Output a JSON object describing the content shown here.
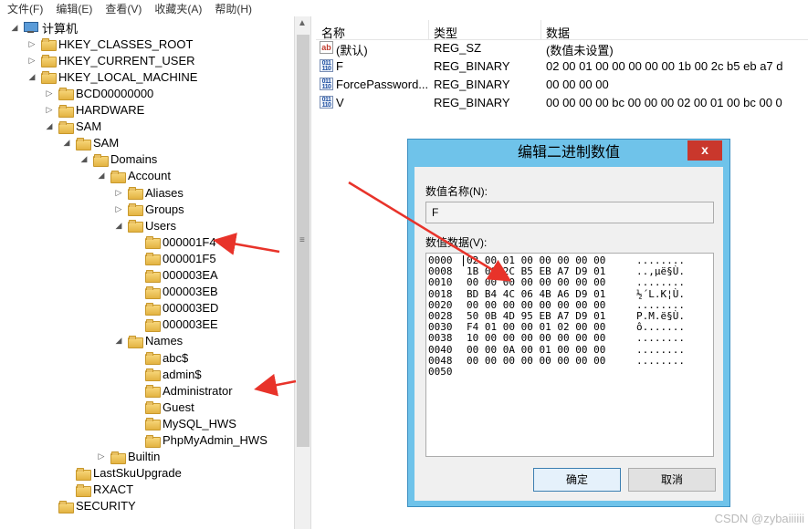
{
  "menubar": [
    "文件(F)",
    "编辑(E)",
    "查看(V)",
    "收藏夹(A)",
    "帮助(H)"
  ],
  "tree": [
    {
      "label": "计算机",
      "exp": "◢",
      "icon": "computer"
    },
    {
      "label": "HKEY_CLASSES_ROOT",
      "exp": "▷"
    },
    {
      "label": "HKEY_CURRENT_USER",
      "exp": "▷"
    },
    {
      "label": "HKEY_LOCAL_MACHINE",
      "exp": "◢"
    },
    {
      "label": "BCD00000000",
      "exp": "▷"
    },
    {
      "label": "HARDWARE",
      "exp": "▷"
    },
    {
      "label": "SAM",
      "exp": "◢"
    },
    {
      "label": "SAM",
      "exp": "◢"
    },
    {
      "label": "Domains",
      "exp": "◢"
    },
    {
      "label": "Account",
      "exp": "◢"
    },
    {
      "label": "Aliases",
      "exp": "▷"
    },
    {
      "label": "Groups",
      "exp": "▷"
    },
    {
      "label": "Users",
      "exp": "◢"
    },
    {
      "label": "000001F4",
      "exp": ""
    },
    {
      "label": "000001F5",
      "exp": ""
    },
    {
      "label": "000003EA",
      "exp": ""
    },
    {
      "label": "000003EB",
      "exp": ""
    },
    {
      "label": "000003ED",
      "exp": ""
    },
    {
      "label": "000003EE",
      "exp": ""
    },
    {
      "label": "Names",
      "exp": "◢"
    },
    {
      "label": "abc$",
      "exp": ""
    },
    {
      "label": "admin$",
      "exp": ""
    },
    {
      "label": "Administrator",
      "exp": ""
    },
    {
      "label": "Guest",
      "exp": ""
    },
    {
      "label": "MySQL_HWS",
      "exp": ""
    },
    {
      "label": "PhpMyAdmin_HWS",
      "exp": ""
    },
    {
      "label": "Builtin",
      "exp": "▷"
    },
    {
      "label": "LastSkuUpgrade",
      "exp": ""
    },
    {
      "label": "RXACT",
      "exp": ""
    },
    {
      "label": "SECURITY",
      "exp": ""
    }
  ],
  "list": {
    "headers": [
      "名称",
      "类型",
      "数据"
    ],
    "rows": [
      {
        "icon": "string-value-icon",
        "name": "(默认)",
        "type": "REG_SZ",
        "data": "(数值未设置)"
      },
      {
        "icon": "binary-value-icon",
        "name": "F",
        "type": "REG_BINARY",
        "data": "02 00 01 00 00 00 00 00 1b 00 2c b5 eb a7 d"
      },
      {
        "icon": "binary-value-icon",
        "name": "ForcePassword...",
        "type": "REG_BINARY",
        "data": "00 00 00 00"
      },
      {
        "icon": "binary-value-icon",
        "name": "V",
        "type": "REG_BINARY",
        "data": "00 00 00 00 bc 00 00 00 02 00 01 00 bc 00 0"
      }
    ]
  },
  "dialog": {
    "title": "编辑二进制数值",
    "close": "x",
    "name_label": "数值名称(N):",
    "name_value": "F",
    "data_label": "数值数据(V):",
    "hex": [
      {
        "off": "0000",
        "bytes": "02 00 01 00 00 00 00 00",
        "ascii": "........"
      },
      {
        "off": "0008",
        "bytes": "1B 00 2C B5 EB A7 D9 01",
        "ascii": "..,µë§Ù."
      },
      {
        "off": "0010",
        "bytes": "00 00 00 00 00 00 00 00",
        "ascii": "........"
      },
      {
        "off": "0018",
        "bytes": "BD B4 4C 06 4B A6 D9 01",
        "ascii": "½´L.K¦Ù."
      },
      {
        "off": "0020",
        "bytes": "00 00 00 00 00 00 00 00",
        "ascii": "........"
      },
      {
        "off": "0028",
        "bytes": "50 0B 4D 95 EB A7 D9 01",
        "ascii": "P.M.ë§Ù."
      },
      {
        "off": "0030",
        "bytes": "F4 01 00 00 01 02 00 00",
        "ascii": "ô......."
      },
      {
        "off": "0038",
        "bytes": "10 00 00 00 00 00 00 00",
        "ascii": "........"
      },
      {
        "off": "0040",
        "bytes": "00 00 0A 00 01 00 00 00",
        "ascii": "........"
      },
      {
        "off": "0048",
        "bytes": "00 00 00 00 00 00 00 00",
        "ascii": "........"
      },
      {
        "off": "0050",
        "bytes": "",
        "ascii": ""
      }
    ],
    "ok": "确定",
    "cancel": "取消"
  },
  "watermark": "CSDN @zybaiiiiii",
  "colors": {
    "dialog_frame": "#6fc3ea",
    "close": "#c9372c",
    "annotation_arrow": "#e8332a"
  }
}
